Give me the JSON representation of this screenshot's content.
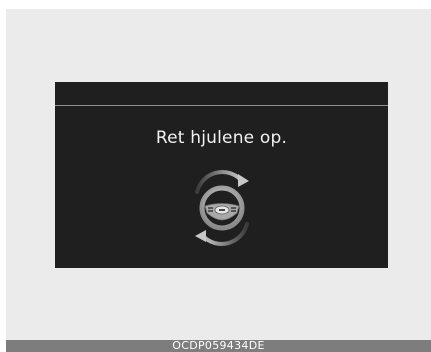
{
  "display": {
    "message": "Ret hjulene op.",
    "icon": "steering-wheel-rotate-icon"
  },
  "caption": {
    "code": "OCDP059434DE"
  },
  "colors": {
    "frame_background": "#ebebeb",
    "screen_background": "#1f1f1f",
    "divider": "#8f8f8f",
    "text": "#f2f2f2",
    "caption_bar": "#7d7d7d"
  }
}
